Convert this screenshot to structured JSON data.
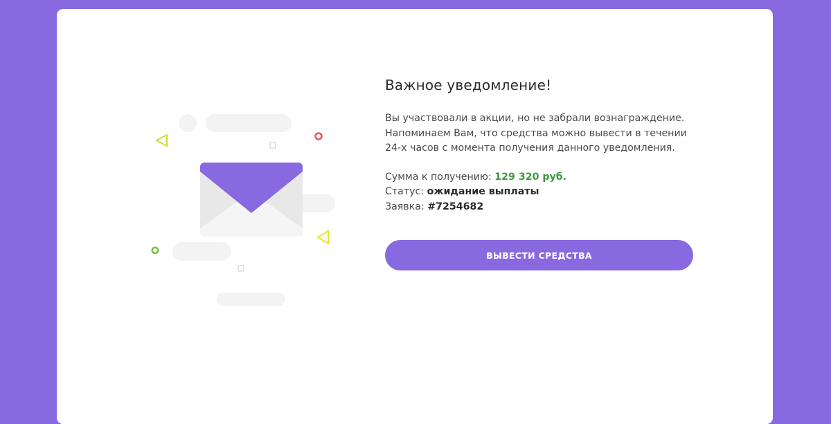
{
  "notice": {
    "title": "Важное уведомление!",
    "message_line1": "Вы участвовали в акции, но не забрали вознаграждение.",
    "message_line2": "Напоминаем Вам, что средства можно вывести в течении",
    "message_line3": "24-х часов с момента получения данного уведомления.",
    "amount_label": "Сумма к получению:",
    "amount_value": "129 320 руб.",
    "status_label": "Статус:",
    "status_value": "ожидание выплаты",
    "request_label": "Заявка:",
    "request_value": "#7254682",
    "button_label": "ВЫВЕСТИ СРЕДСТВА"
  },
  "colors": {
    "background": "#8869e0",
    "accent": "#8869e0",
    "amount": "#3a9a3e",
    "card": "#ffffff"
  },
  "icons": [
    "envelope-icon",
    "triangle-icon",
    "circle-icon",
    "square-icon"
  ]
}
